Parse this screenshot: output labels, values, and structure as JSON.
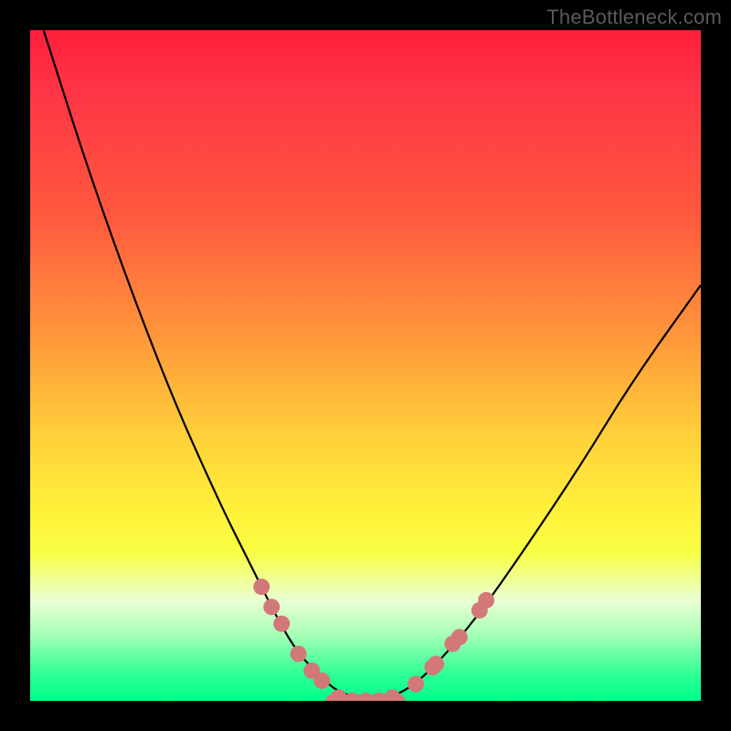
{
  "watermark": "TheBottleneck.com",
  "chart_data": {
    "type": "line",
    "title": "",
    "xlabel": "",
    "ylabel": "",
    "xlim": [
      0,
      100
    ],
    "ylim": [
      0,
      100
    ],
    "series": [
      {
        "name": "left-curve",
        "x": [
          2,
          10,
          20,
          28,
          33,
          37,
          40,
          43,
          45,
          47,
          49,
          50
        ],
        "y": [
          100,
          75,
          48,
          30,
          20,
          12,
          7,
          4,
          2,
          1,
          0.3,
          0
        ]
      },
      {
        "name": "right-curve",
        "x": [
          50,
          52,
          55,
          58,
          62,
          67,
          74,
          82,
          90,
          100
        ],
        "y": [
          0,
          0.3,
          1,
          3,
          7,
          13,
          23,
          35,
          48,
          62
        ]
      },
      {
        "name": "floor",
        "x": [
          45,
          55
        ],
        "y": [
          0,
          0
        ]
      }
    ],
    "markers": [
      {
        "x": 34.5,
        "y": 17.0
      },
      {
        "x": 36.0,
        "y": 14.0
      },
      {
        "x": 37.5,
        "y": 11.5
      },
      {
        "x": 40.0,
        "y": 7.0
      },
      {
        "x": 42.0,
        "y": 4.5
      },
      {
        "x": 43.5,
        "y": 3.0
      },
      {
        "x": 46.0,
        "y": 0.5
      },
      {
        "x": 48.0,
        "y": 0.0
      },
      {
        "x": 50.0,
        "y": 0.0
      },
      {
        "x": 52.0,
        "y": 0.0
      },
      {
        "x": 54.0,
        "y": 0.5
      },
      {
        "x": 57.5,
        "y": 2.5
      },
      {
        "x": 60.0,
        "y": 5.0
      },
      {
        "x": 60.5,
        "y": 5.5
      },
      {
        "x": 63.0,
        "y": 8.5
      },
      {
        "x": 64.0,
        "y": 9.5
      },
      {
        "x": 67.0,
        "y": 13.5
      },
      {
        "x": 68.0,
        "y": 15.0
      }
    ],
    "gradient_stops": [
      {
        "pos": 0,
        "color": "#ff1f3a"
      },
      {
        "pos": 28,
        "color": "#ff5a3e"
      },
      {
        "pos": 60,
        "color": "#ffcf3a"
      },
      {
        "pos": 78,
        "color": "#f8ff44"
      },
      {
        "pos": 100,
        "color": "#00ff8a"
      }
    ]
  }
}
